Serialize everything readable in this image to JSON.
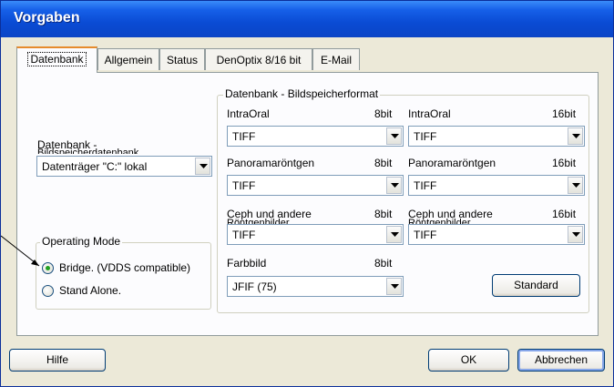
{
  "window": {
    "title": "Vorgaben"
  },
  "tabs": [
    {
      "label": "Datenbank",
      "active": true
    },
    {
      "label": "Allgemein",
      "active": false
    },
    {
      "label": "Status",
      "active": false
    },
    {
      "label": "DenOptix 8/16 bit",
      "active": false
    },
    {
      "label": "E-Mail",
      "active": false
    }
  ],
  "datenbank": {
    "label": "Datenbank -",
    "label_clipped": "Bildspeicherdatenbank",
    "selected": "Datenträger \"C:\" lokal"
  },
  "operating_mode": {
    "title": "Operating Mode",
    "options": [
      {
        "label": "Bridge. (VDDS compatible)",
        "checked": true
      },
      {
        "label": "Stand Alone.",
        "checked": false
      }
    ]
  },
  "bildspeicher": {
    "title": "Datenbank - Bildspeicherformat",
    "rows": [
      {
        "left": {
          "label": "IntraOral",
          "depth": "8bit",
          "value": "TIFF"
        },
        "right": {
          "label": "IntraOral",
          "depth": "16bit",
          "value": "TIFF"
        }
      },
      {
        "left": {
          "label": "Panoramaröntgen",
          "depth": "8bit",
          "value": "TIFF"
        },
        "right": {
          "label": "Panoramaröntgen",
          "depth": "16bit",
          "value": "TIFF"
        }
      },
      {
        "left": {
          "label": "Ceph und andere",
          "label_clipped": "Röntgenbilder",
          "depth": "8bit",
          "value": "TIFF"
        },
        "right": {
          "label": "Ceph und andere",
          "label_clipped": "Röntgenbilder",
          "depth": "16bit",
          "value": "TIFF"
        }
      }
    ],
    "farbbild": {
      "label": "Farbbild",
      "depth": "8bit",
      "value": "JFIF (75)"
    },
    "standard_button": "Standard"
  },
  "footer": {
    "help": "Hilfe",
    "ok": "OK",
    "cancel": "Abbrechen"
  },
  "colors": {
    "titlebar": "#0a4bd4",
    "face": "#ece9d8",
    "panel": "#fcfcfe",
    "radio_dot": "#21a121",
    "button_border": "#003c74"
  },
  "icons": {
    "dropdown": "chevron-down-icon"
  }
}
